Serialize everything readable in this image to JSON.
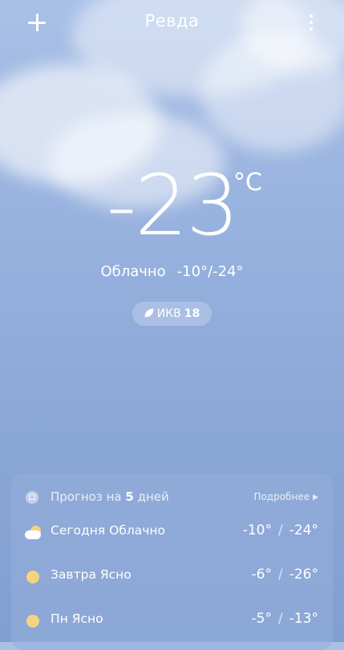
{
  "header": {
    "city": "Ревда"
  },
  "current": {
    "temperature": "-23",
    "unit": "°C",
    "condition": "Облачно",
    "high_low": "-10°/-24°"
  },
  "aqi": {
    "label": "ИКВ",
    "value": "18"
  },
  "forecast": {
    "title_prefix": "Прогноз на",
    "days_count": "5",
    "title_suffix": "дней",
    "more_label": "Подробнее",
    "days": [
      {
        "label": "Сегодня Облачно",
        "icon": "cloudy-icon",
        "high": "-10°",
        "low": "-24°"
      },
      {
        "label": "Завтра Ясно",
        "icon": "sun-icon",
        "high": "-6°",
        "low": "-26°"
      },
      {
        "label": "Пн Ясно",
        "icon": "sun-icon",
        "high": "-5°",
        "low": "-13°"
      }
    ]
  },
  "colors": {
    "sky_top": "#a9c0e6",
    "sky_bottom": "#829fd2",
    "sun": "#f6d37f"
  }
}
